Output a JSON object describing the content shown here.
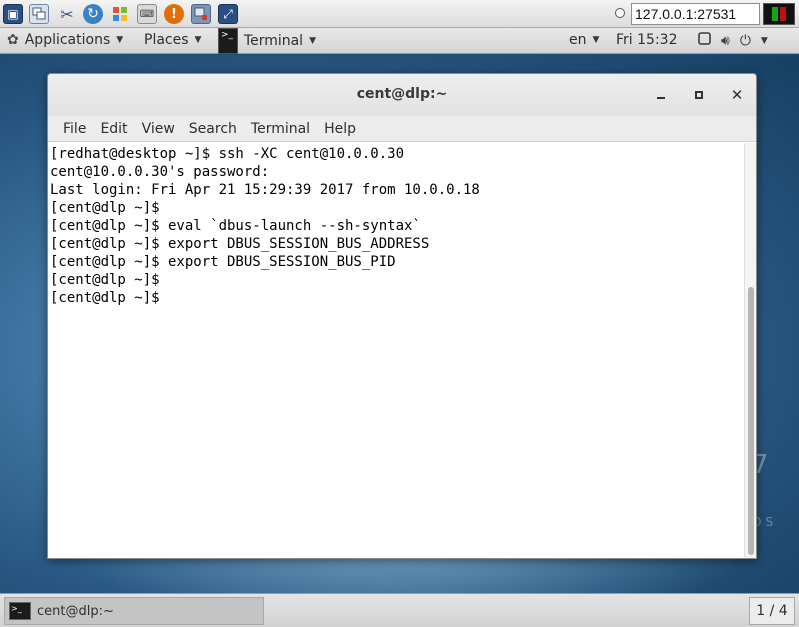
{
  "viewer_toolbar": {
    "address": "127.0.0.1:27531",
    "icons": [
      "monitor-icon",
      "windows-icon",
      "tools-icon",
      "refresh-icon",
      "windows-logo-icon",
      "keyboard-icon",
      "alert-icon",
      "disconnect-icon",
      "fullscreen-icon",
      "signal-icon"
    ],
    "signal_colors": [
      "#1aa31a",
      "#c40f0f"
    ]
  },
  "topbar": {
    "applications_label": "Applications",
    "places_label": "Places",
    "app_menu_label": "Terminal",
    "language": "en",
    "clock": "Fri 15:32"
  },
  "window": {
    "title": "cent@dlp:~",
    "menus": [
      "File",
      "Edit",
      "View",
      "Search",
      "Terminal",
      "Help"
    ]
  },
  "terminal": {
    "lines": [
      "[redhat@desktop ~]$ ssh -XC cent@10.0.0.30",
      "cent@10.0.0.30's password:",
      "Last login: Fri Apr 21 15:29:39 2017 from 10.0.0.18",
      "[cent@dlp ~]$",
      "[cent@dlp ~]$ eval `dbus-launch --sh-syntax`",
      "[cent@dlp ~]$ export DBUS_SESSION_BUS_ADDRESS",
      "[cent@dlp ~]$ export DBUS_SESSION_BUS_PID",
      "[cent@dlp ~]$",
      "[cent@dlp ~]$"
    ]
  },
  "taskbar": {
    "item_label": "cent@dlp:~",
    "workspace": "1 / 4"
  },
  "wallpaper": {
    "seven": "7",
    "brand": "OS"
  },
  "colors": {
    "desktop": "#2f6593",
    "terminal_bg": "#ffffff",
    "terminal_fg": "#000000"
  }
}
